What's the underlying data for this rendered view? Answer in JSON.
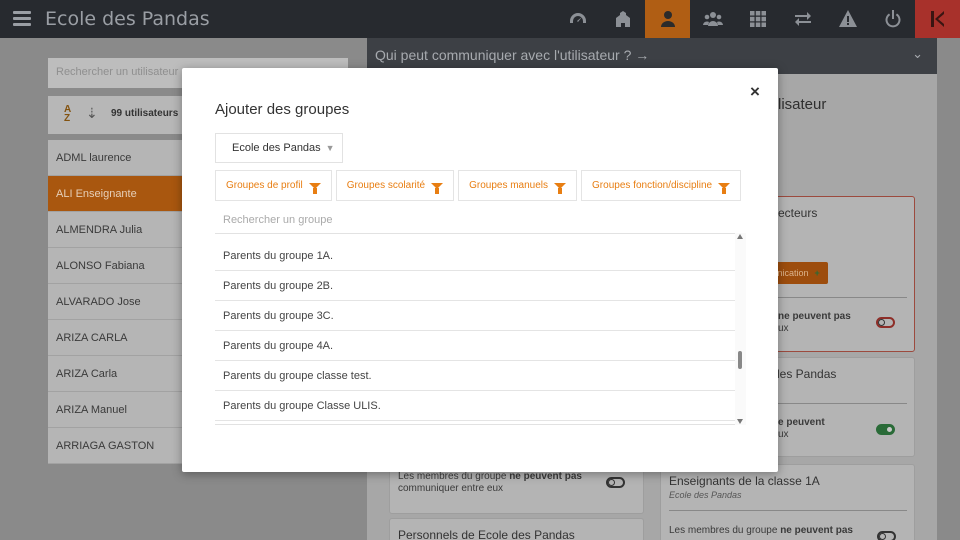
{
  "header": {
    "app_title": "Ecole des Pandas",
    "nav_icons": [
      "dashboard-icon",
      "school-icon",
      "user-icon",
      "users-icon",
      "grid-icon",
      "transfer-icon",
      "warning-icon",
      "power-icon",
      "exit-icon"
    ],
    "active_color": "#e87e12",
    "danger_color": "#c0392b"
  },
  "sidebar": {
    "search_placeholder": "Rechercher un utilisateur",
    "sort_az": "A Z",
    "user_count": "99 utilisateurs",
    "users": [
      "ADML laurence",
      "ALI Enseignante",
      "ALMENDRA Julia",
      "ALONSO Fabiana",
      "ALVARADO Jose",
      "ARIZA CARLA",
      "ARIZA Carla",
      "ARIZA Manuel",
      "ARRIAGA GASTON"
    ],
    "selected_user": "ALI Enseignante"
  },
  "main": {
    "section_title": "Qui peut communiquer avec l'utilisateur ? →",
    "title_fragment": "lisateur",
    "cards": {
      "directeurs_title": "ecteurs",
      "communication_btn": "munication",
      "directeurs_toggle_text_line1": "ne peuvent pas",
      "directeurs_toggle_text_line2": "ux",
      "pandas_title": "des Pandas",
      "pandas_toggle_text_line1": "e peuvent",
      "pandas_toggle_text_line2": "ux",
      "groupe_text_prefix": "Les membres du groupe",
      "groupe_text_bold": "ne peuvent pas",
      "groupe_text_line2": "communiquer entre eux",
      "personnels_title": "Personnels de Ecole des Pandas",
      "enseignants_title": "Enseignants de la classe 1A",
      "enseignants_sub": "Ecole des Pandas",
      "enseignants_text_prefix": "Les membres du groupe",
      "enseignants_text_bold": "ne peuvent pas"
    }
  },
  "modal": {
    "title": "Ajouter des groupes",
    "close_label": "×",
    "school_select_value": "Ecole des Pandas",
    "filters": [
      "Groupes de profil",
      "Groupes scolarité",
      "Groupes manuels",
      "Groupes fonction/discipline"
    ],
    "group_search_placeholder": "Rechercher un groupe",
    "groups": [
      "Parents du groupe 1A.",
      "Parents du groupe 2B.",
      "Parents du groupe 3C.",
      "Parents du groupe 4A.",
      "Parents du groupe classe test.",
      "Parents du groupe Classe ULIS."
    ]
  }
}
